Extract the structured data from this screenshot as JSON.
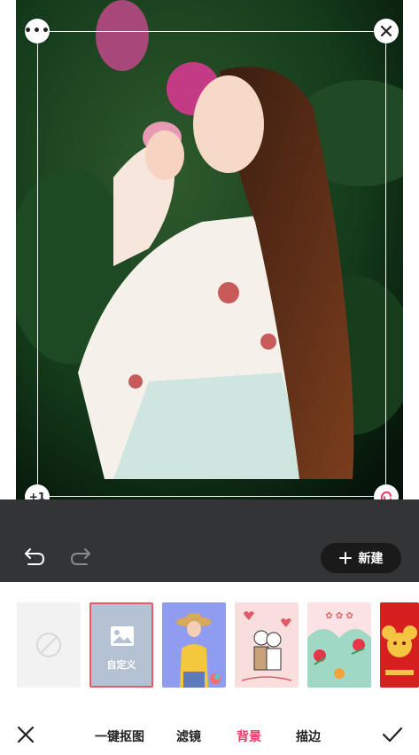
{
  "editor": {
    "corner_plus_label": "+1"
  },
  "toolbar": {
    "new_label": "新建"
  },
  "backgrounds": {
    "custom_label": "自定义",
    "items": [
      "none",
      "custom",
      "photo-girl-hat",
      "illustration-couple",
      "floral-chinese",
      "red-festive"
    ]
  },
  "tabs": [
    {
      "label": "一键抠图",
      "active": false
    },
    {
      "label": "滤镜",
      "active": false
    },
    {
      "label": "背景",
      "active": true
    },
    {
      "label": "描边",
      "active": false
    }
  ],
  "colors": {
    "accent": "#ff3366",
    "dark_toolbar": "#333436",
    "selected_border": "#e85a6a"
  }
}
